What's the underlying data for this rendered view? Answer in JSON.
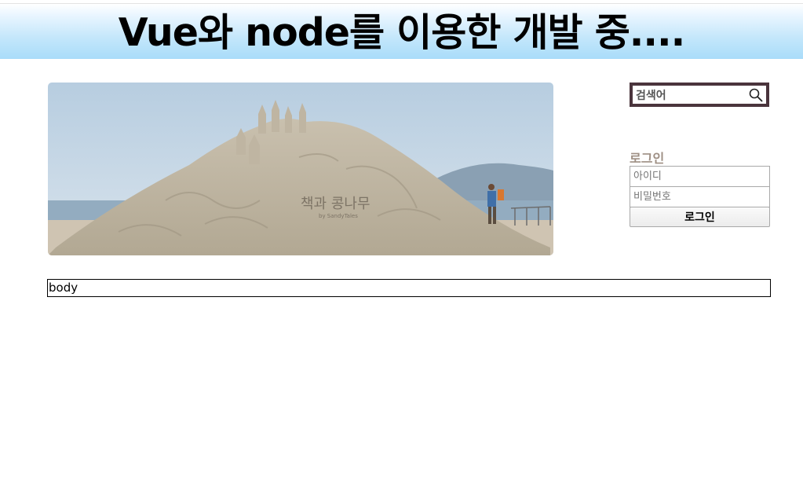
{
  "header": {
    "title": "Vue와 node를 이용한 개발 중...."
  },
  "hero": {
    "caption": "책과 콩나무",
    "sub_caption": "by SandyTales"
  },
  "search": {
    "placeholder": "검색어",
    "icon": "search-icon"
  },
  "login": {
    "heading": "로그인",
    "id_placeholder": "아이디",
    "password_placeholder": "비밀번호",
    "button_label": "로그인"
  },
  "main": {
    "body_text": "body"
  },
  "colors": {
    "header_gradient_top": "#ffffff",
    "header_gradient_bottom": "#a9dcfa",
    "search_border": "#4a343c",
    "login_heading": "#9e8f84"
  }
}
